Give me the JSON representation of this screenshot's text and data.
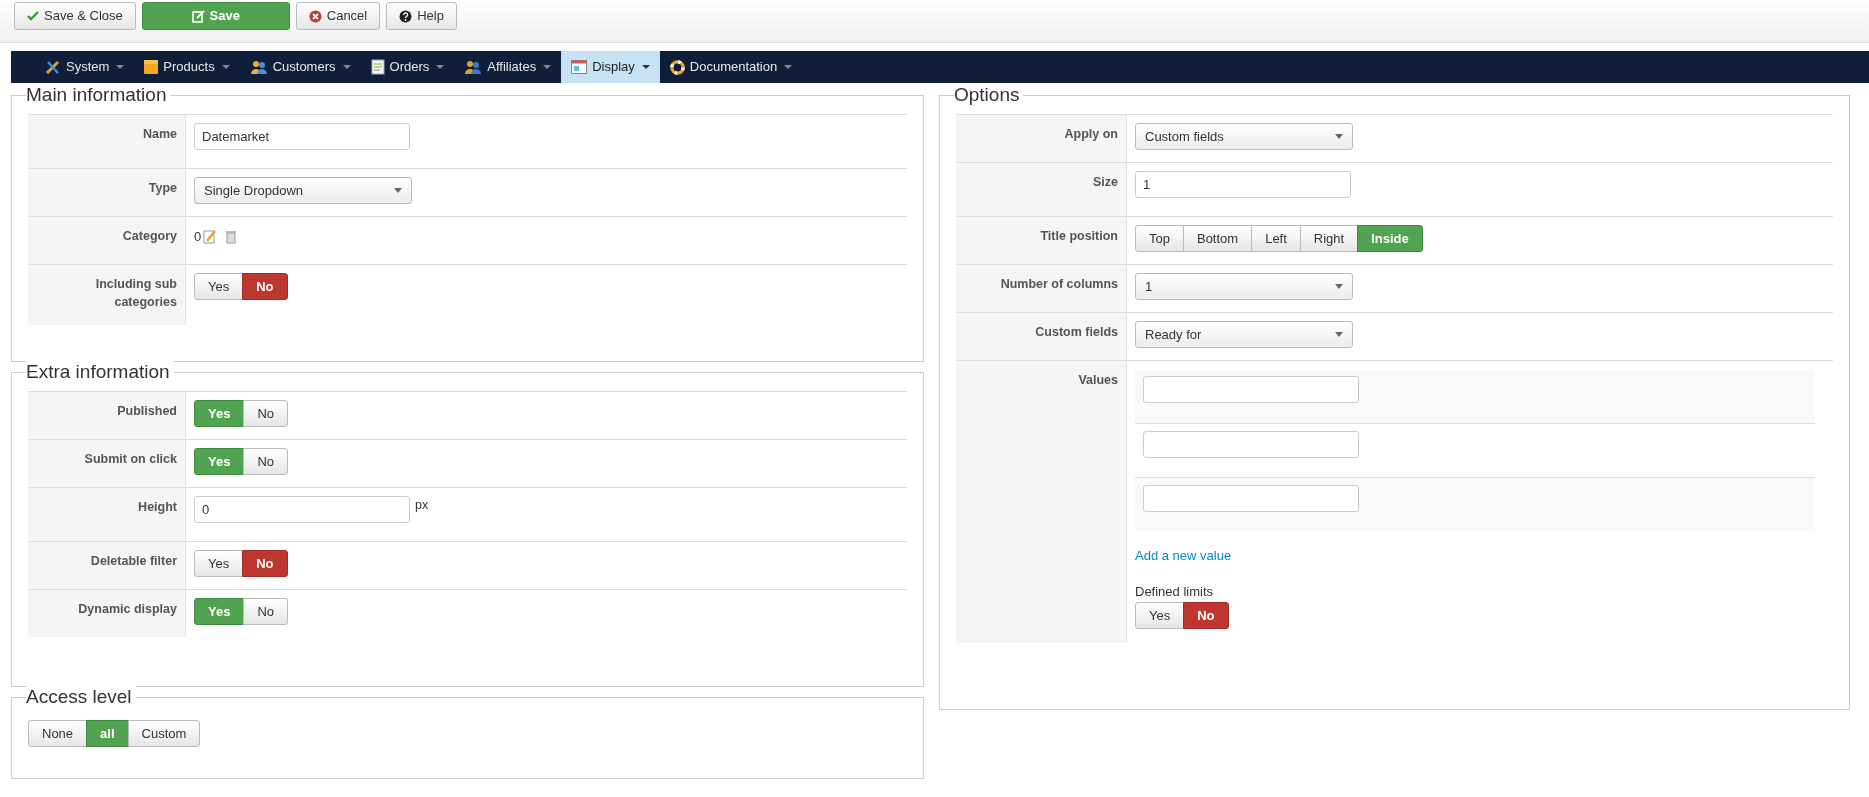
{
  "toolbar": [
    {
      "label": "Save & Close",
      "kind": "default"
    },
    {
      "label": "Save",
      "kind": "primary"
    },
    {
      "label": "Cancel",
      "kind": "default"
    },
    {
      "label": "Help",
      "kind": "default"
    }
  ],
  "menu": [
    {
      "label": "System",
      "selected": false
    },
    {
      "label": "Products",
      "selected": false
    },
    {
      "label": "Customers",
      "selected": false
    },
    {
      "label": "Orders",
      "selected": false
    },
    {
      "label": "Affiliates",
      "selected": false
    },
    {
      "label": "Display",
      "selected": true
    },
    {
      "label": "Documentation",
      "selected": false
    }
  ],
  "main_information": {
    "title": "Main information",
    "rows": [
      {
        "label": "Name",
        "kind": "text",
        "value": "Datemarket"
      },
      {
        "label": "Type",
        "kind": "select",
        "value": "Single Dropdown"
      },
      {
        "label": "Category",
        "kind": "category",
        "value": "0"
      },
      {
        "label": "Including sub categories",
        "kind": "toggle",
        "danger": true,
        "options": [
          {
            "label": "Yes",
            "selected": false
          },
          {
            "label": "No",
            "selected": true
          }
        ]
      }
    ]
  },
  "extra_information": {
    "title": "Extra information",
    "rows": [
      {
        "label": "Published",
        "kind": "toggle",
        "danger": false,
        "options": [
          {
            "label": "Yes",
            "selected": true
          },
          {
            "label": "No",
            "selected": false
          }
        ]
      },
      {
        "label": "Submit on click",
        "kind": "toggle",
        "danger": false,
        "options": [
          {
            "label": "Yes",
            "selected": true
          },
          {
            "label": "No",
            "selected": false
          }
        ]
      },
      {
        "label": "Height",
        "kind": "text",
        "value": "0",
        "suffix": "px"
      },
      {
        "label": "Deletable filter",
        "kind": "toggle",
        "danger": true,
        "options": [
          {
            "label": "Yes",
            "selected": false
          },
          {
            "label": "No",
            "selected": true
          }
        ]
      },
      {
        "label": "Dynamic display",
        "kind": "toggle",
        "danger": false,
        "options": [
          {
            "label": "Yes",
            "selected": true
          },
          {
            "label": "No",
            "selected": false
          }
        ]
      }
    ]
  },
  "access_level": {
    "title": "Access level",
    "danger": false,
    "options": [
      {
        "label": "None",
        "selected": false
      },
      {
        "label": "all",
        "selected": true
      },
      {
        "label": "Custom",
        "selected": false
      }
    ]
  },
  "options": {
    "title": "Options",
    "rows": [
      {
        "label": "Apply on",
        "kind": "select",
        "value": "Custom fields"
      },
      {
        "label": "Size",
        "kind": "text",
        "value": "1"
      },
      {
        "label": "Title position",
        "kind": "toggle",
        "danger": false,
        "options": [
          {
            "label": "Top",
            "selected": false
          },
          {
            "label": "Bottom",
            "selected": false
          },
          {
            "label": "Left",
            "selected": false
          },
          {
            "label": "Right",
            "selected": false
          },
          {
            "label": "Inside",
            "selected": true
          }
        ]
      },
      {
        "label": "Number of columns",
        "kind": "select",
        "value": "1"
      },
      {
        "label": "Custom fields",
        "kind": "select",
        "value": "Ready for"
      },
      {
        "label": "Values",
        "kind": "values",
        "link": "Add a new value",
        "sub_label": "Defined limits",
        "danger": true,
        "options": [
          {
            "label": "Yes",
            "selected": false
          },
          {
            "label": "No",
            "selected": true
          }
        ]
      }
    ]
  }
}
